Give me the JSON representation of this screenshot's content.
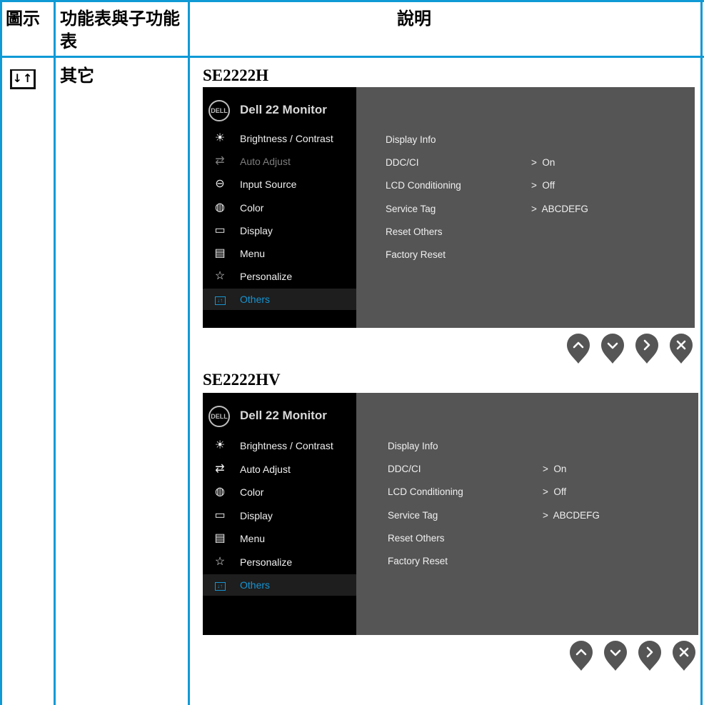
{
  "table": {
    "headers": {
      "icon": "圖示",
      "menu": "功能表與子功能表",
      "desc": "說明"
    },
    "row": {
      "menu_name": "其它"
    }
  },
  "models": [
    {
      "name": "SE2222H",
      "osd": {
        "title": "Dell 22 Monitor",
        "logo": "DELL",
        "menu": [
          {
            "label": "Brightness / Contrast",
            "icon": "sun-icon",
            "state": "normal"
          },
          {
            "label": "Auto Adjust",
            "icon": "auto-adjust-icon",
            "state": "disabled"
          },
          {
            "label": "Input Source",
            "icon": "input-source-icon",
            "state": "normal"
          },
          {
            "label": "Color",
            "icon": "color-icon",
            "state": "normal"
          },
          {
            "label": "Display",
            "icon": "display-icon",
            "state": "normal"
          },
          {
            "label": "Menu",
            "icon": "menu-icon",
            "state": "normal"
          },
          {
            "label": "Personalize",
            "icon": "star-icon",
            "state": "normal"
          },
          {
            "label": "Others",
            "icon": "others-icon",
            "state": "selected"
          }
        ],
        "submenu": [
          {
            "label": "Display Info",
            "value": ""
          },
          {
            "label": "DDC/CI",
            "value": ">  On"
          },
          {
            "label": "LCD Conditioning",
            "value": ">  Off"
          },
          {
            "label": "Service Tag",
            "value": ">  ABCDEFG"
          },
          {
            "label": "Reset Others",
            "value": ""
          },
          {
            "label": "Factory Reset",
            "value": ""
          }
        ]
      }
    },
    {
      "name": "SE2222HV",
      "osd": {
        "title": "Dell 22 Monitor",
        "logo": "DELL",
        "menu": [
          {
            "label": "Brightness / Contrast",
            "icon": "sun-icon",
            "state": "normal"
          },
          {
            "label": "Auto Adjust",
            "icon": "auto-adjust-icon",
            "state": "normal"
          },
          {
            "label": "Color",
            "icon": "color-icon",
            "state": "normal"
          },
          {
            "label": "Display",
            "icon": "display-icon",
            "state": "normal"
          },
          {
            "label": "Menu",
            "icon": "menu-icon",
            "state": "normal"
          },
          {
            "label": "Personalize",
            "icon": "star-icon",
            "state": "normal"
          },
          {
            "label": "Others",
            "icon": "others-icon",
            "state": "selected"
          }
        ],
        "submenu": [
          {
            "label": "Display Info",
            "value": ""
          },
          {
            "label": "DDC/CI",
            "value": ">  On"
          },
          {
            "label": "LCD Conditioning",
            "value": ">  Off"
          },
          {
            "label": "Service Tag",
            "value": ">  ABCDEFG"
          },
          {
            "label": "Reset Others",
            "value": ""
          },
          {
            "label": "Factory Reset",
            "value": ""
          }
        ]
      }
    }
  ],
  "buttons": [
    "up-button",
    "down-button",
    "right-button",
    "close-button"
  ],
  "colors": {
    "border": "#0f9ad6",
    "osd_right": "#555555",
    "osd_left": "#000000",
    "selected": "#1794d1",
    "button": "#555555"
  }
}
